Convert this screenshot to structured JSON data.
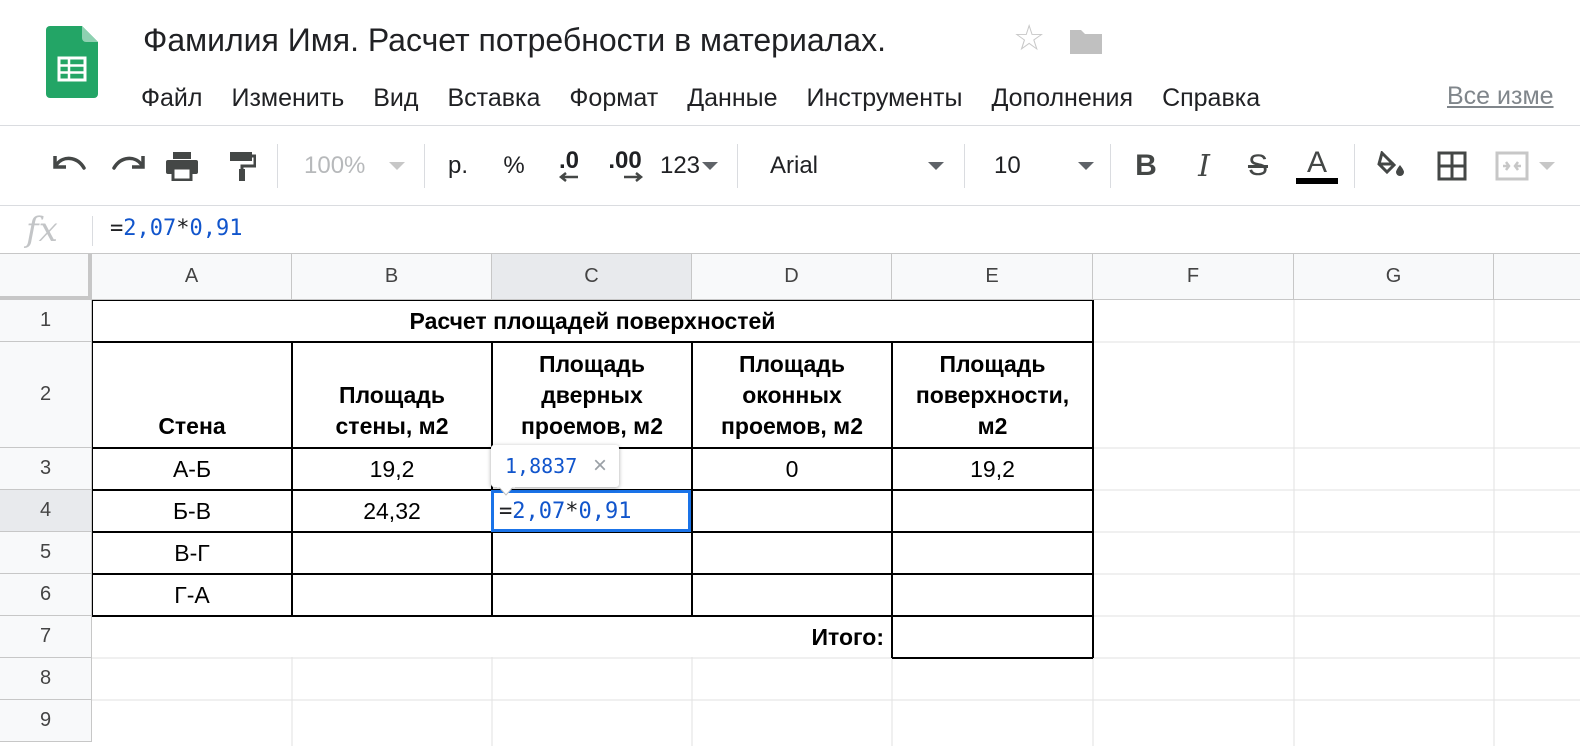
{
  "doc": {
    "title": "Фамилия Имя. Расчет потребности в материалах."
  },
  "menu": {
    "items": [
      "Файл",
      "Изменить",
      "Вид",
      "Вставка",
      "Формат",
      "Данные",
      "Инструменты",
      "Дополнения",
      "Справка"
    ],
    "last_edit": "Все изме"
  },
  "toolbar": {
    "zoom": "100%",
    "currency": "р.",
    "percent": "%",
    "decrease_decimals": ".0",
    "increase_decimals": ".00",
    "more_formats": "123",
    "font": "Arial",
    "font_size": "10"
  },
  "formula_bar": {
    "fx_label": "fx",
    "eq": "=",
    "n1": "2,07",
    "op": "*",
    "n2": "0,91"
  },
  "grid": {
    "columns": [
      "A",
      "B",
      "C",
      "D",
      "E",
      "F",
      "G"
    ],
    "rows": [
      "1",
      "2",
      "3",
      "4",
      "5",
      "6",
      "7",
      "8",
      "9"
    ],
    "selected_column": "C",
    "selected_row": "4",
    "table_title": "Расчет площадей поверхностей",
    "headers": {
      "wall": "Стена",
      "wall_area": "Площадь стены, м2",
      "door_area": "Площадь дверных проемов, м2",
      "window_area": "Площадь оконных проемов, м2",
      "surface_area": "Площадь поверхности, м2"
    },
    "walls": [
      "А-Б",
      "Б-В",
      "В-Г",
      "Г-А"
    ],
    "wall_areas": [
      "19,2",
      "24,32"
    ],
    "window_area_ab": "0",
    "surface_area_ab": "19,2",
    "total_label": "Итого:"
  },
  "active_cell": {
    "eq": "=",
    "n1": "2,07",
    "op": "*",
    "n2": "0,91"
  },
  "tooltip": {
    "preview": "1,8837",
    "close": "×"
  },
  "colors": {
    "accent": "#1a73e8",
    "number": "#1155cc",
    "sheets_green": "#23a566"
  }
}
